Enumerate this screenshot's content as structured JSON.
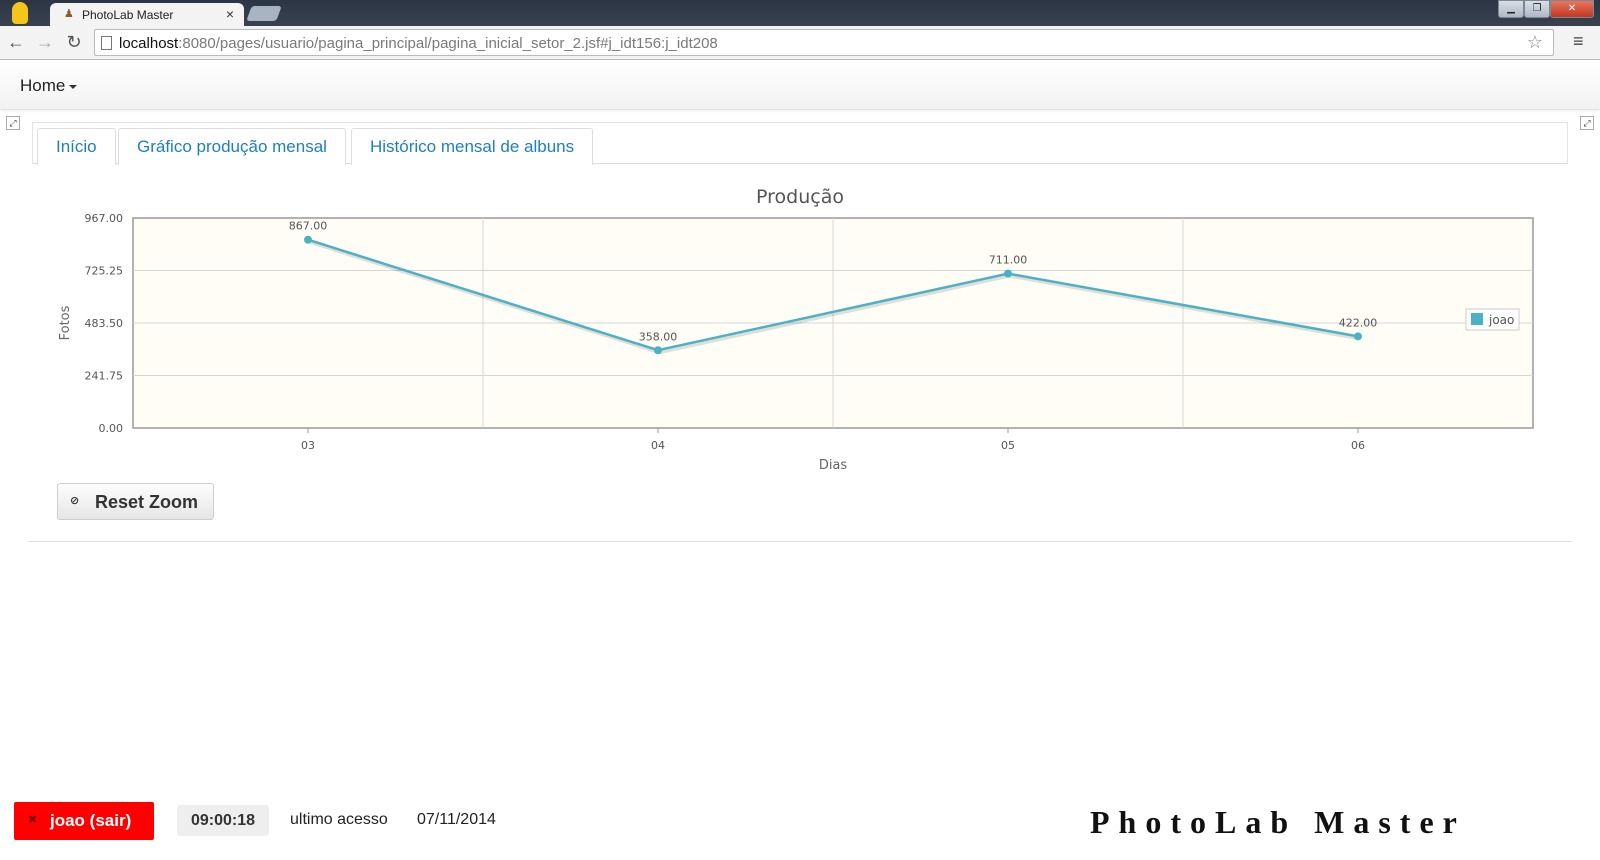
{
  "browser": {
    "tab_title": "PhotoLab Master",
    "tab_close": "×",
    "url_host": "localhost",
    "url_rest": ":8080/pages/usuario/pagina_principal/pagina_inicial_setor_2.jsf#j_idt156:j_idt208",
    "icons": [
      "back-icon",
      "forward-icon",
      "reload-icon",
      "page-icon",
      "star-icon",
      "menu-icon"
    ]
  },
  "navbar": {
    "home_label": "Home"
  },
  "tabs": [
    {
      "label": "Início"
    },
    {
      "label": "Gráfico produção mensal"
    },
    {
      "label": "Histórico mensal de albuns"
    }
  ],
  "chart_data": {
    "type": "line",
    "title": "Produção",
    "xlabel": "Dias",
    "ylabel": "Fotos",
    "categories": [
      "03",
      "04",
      "05",
      "06"
    ],
    "series": [
      {
        "name": "joao",
        "values": [
          867.0,
          358.0,
          711.0,
          422.0
        ],
        "color": "#4bb2c5"
      }
    ],
    "data_labels": [
      "867.00",
      "358.00",
      "711.00",
      "422.00"
    ],
    "yticks": [
      "0.00",
      "241.75",
      "483.50",
      "725.25",
      "967.00"
    ],
    "ylim": [
      0,
      967
    ],
    "grid": true,
    "legend": "right",
    "background": "#fffdf6"
  },
  "reset_zoom": {
    "label": "Reset Zoom"
  },
  "footer": {
    "logout_label": "joao (sair)",
    "timer": "09:00:18",
    "last_access_label": "ultimo acesso",
    "last_access_date": "07/11/2014",
    "brand": "PhotoLab Master"
  }
}
